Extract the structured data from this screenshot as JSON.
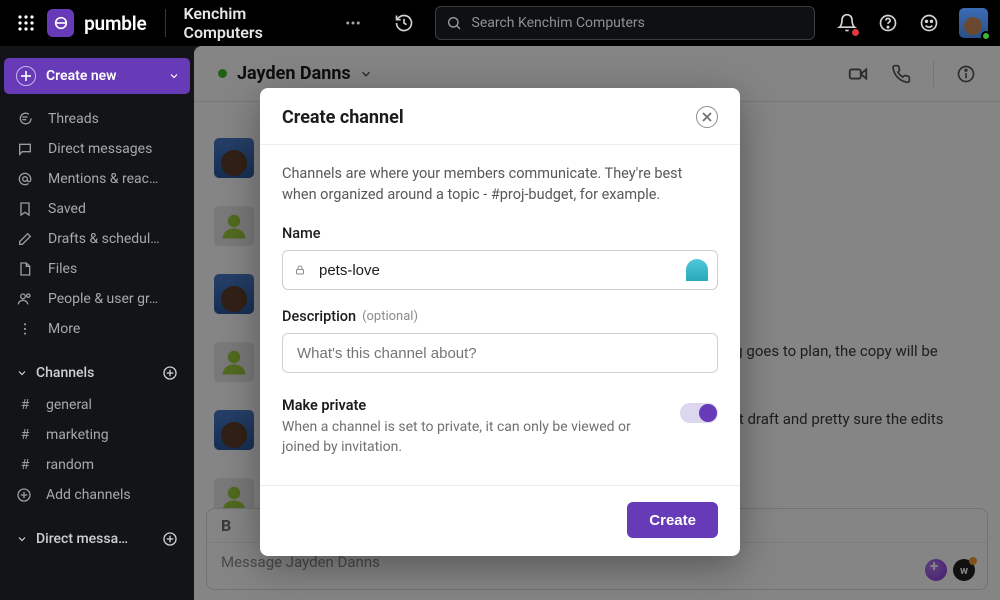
{
  "brand": {
    "name": "pumble"
  },
  "workspace": {
    "name": "Kenchim Computers"
  },
  "search": {
    "placeholder": "Search Kenchim Computers"
  },
  "sidebar": {
    "create_label": "Create new",
    "nav": [
      {
        "label": "Threads"
      },
      {
        "label": "Direct messages"
      },
      {
        "label": "Mentions & reac…"
      },
      {
        "label": "Saved"
      },
      {
        "label": "Drafts & schedul…"
      },
      {
        "label": "Files"
      },
      {
        "label": "People & user gr…"
      },
      {
        "label": "More"
      }
    ],
    "channels_header": "Channels",
    "channels": [
      {
        "name": "general"
      },
      {
        "name": "marketing"
      },
      {
        "name": "random"
      }
    ],
    "add_channels_label": "Add channels",
    "dm_header": "Direct messa…"
  },
  "chat": {
    "title": "Jayden Danns",
    "snippet_1": "ng goes to plan, the copy will be",
    "snippet_2": "rst draft and pretty sure the edits",
    "composer_placeholder": "Message Jayden Danns",
    "bold_label": "B",
    "wave_label": "w"
  },
  "modal": {
    "title": "Create channel",
    "description": "Channels are where your members communicate. They're best when organized around a topic - #proj-budget, for example.",
    "name_label": "Name",
    "name_value": "pets-love",
    "desc_label": "Description",
    "desc_optional": "(optional)",
    "desc_placeholder": "What's this channel about?",
    "private_title": "Make private",
    "private_sub": "When a channel is set to private, it can only be viewed or joined by invitation.",
    "create_button": "Create"
  }
}
